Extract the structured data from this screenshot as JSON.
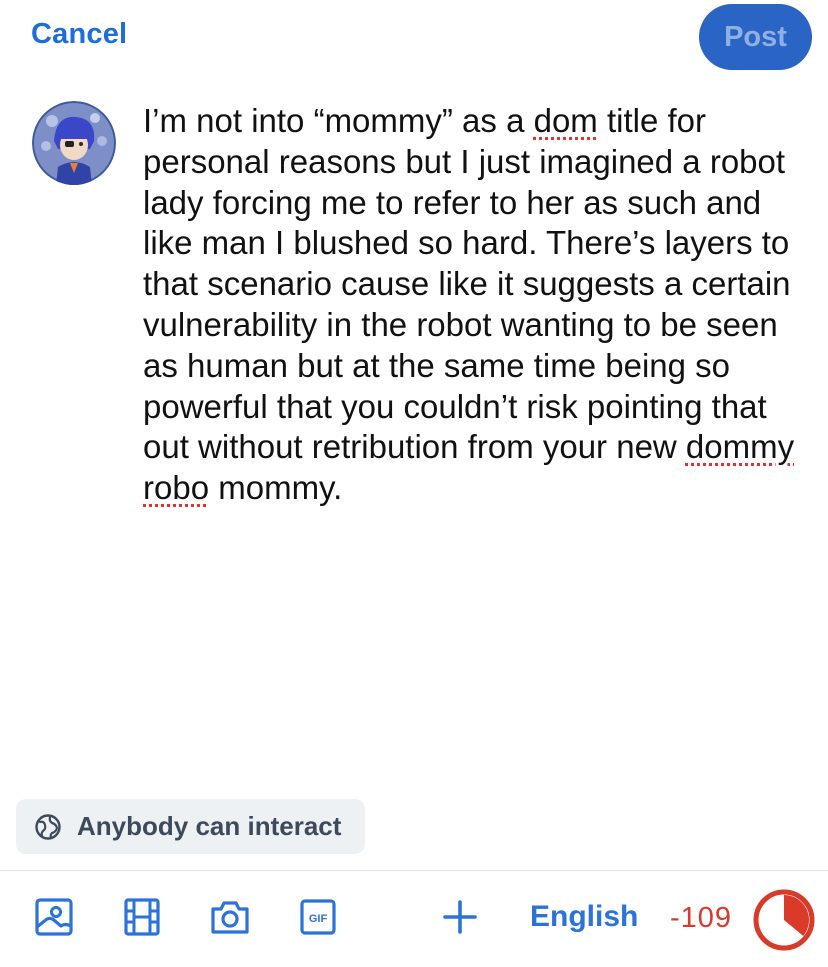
{
  "header": {
    "cancel_label": "Cancel",
    "post_label": "Post"
  },
  "compose": {
    "text_part1": "I’m not into “mommy” as a ",
    "misspelled1": "dom",
    "text_part2": " title for personal reasons but I just imagined a robot lady forcing me to refer to her as such and like man I blushed so hard. There’s layers to that scenario cause like it suggests a certain vulnerability in the robot wanting to be seen as human but at the same time being so powerful that you couldn’t risk pointing that out without retribution from your new ",
    "misspelled2": "dommy",
    "space": " ",
    "misspelled3": "robo",
    "text_part3": " mommy."
  },
  "interaction": {
    "label": "Anybody can interact",
    "icon": "globe-icon"
  },
  "toolbar": {
    "icons": [
      "image-icon",
      "video-icon",
      "camera-icon",
      "gif-icon",
      "plus-icon"
    ],
    "language_label": "English",
    "char_count": "-109",
    "over_limit_fraction": 0.36
  },
  "colors": {
    "accent": "#1c6fd8",
    "post_button": "#2a64c5",
    "error": "#d93a2a"
  }
}
